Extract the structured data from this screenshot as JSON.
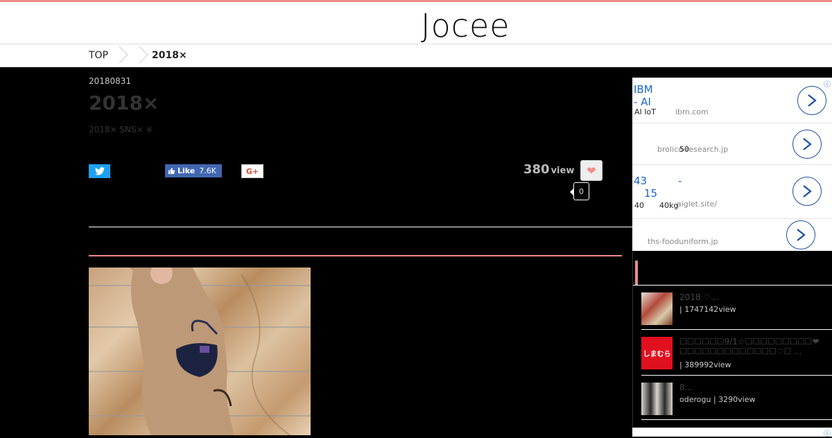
{
  "site": {
    "logo": "Jocee"
  },
  "breadcrumb": {
    "top": "TOP",
    "current": "2018×"
  },
  "article": {
    "date": "20180831",
    "title": "2018×",
    "description": "2018× SNS× ※",
    "views": "380",
    "views_label": "view",
    "like_count": "0"
  },
  "share": {
    "facebook_label": "Like",
    "facebook_count": "7.6K",
    "gplus_label": "G+"
  },
  "ads": [
    {
      "title_line1": "IBM",
      "title_line2": "- AI",
      "sub": "AI IoT",
      "url": "ibm.com"
    },
    {
      "sub": "50",
      "url": "brolico-research.jp"
    },
    {
      "title_line1": "43　　　-",
      "title_line2": "　15",
      "sub": "40　　40kg",
      "url": "aiglet.site/"
    },
    {
      "url": "ths-fooduniform.jp"
    }
  ],
  "ranking": [
    {
      "title": "2018 ♡...",
      "meta": " | 1747142view",
      "thumb_color": "#b04a3a"
    },
    {
      "title": "☐☐☐☐☐☐9/1☆☐☐☐☐☐☐☐☐☐❤☐☐☐☐☐☐☐☐☐☐☐☐☐♡☐ ...",
      "meta": " | 389992view",
      "thumb_label": "しまむら",
      "thumb_color": "#e0101f"
    },
    {
      "title": "8...",
      "meta": "oderogu | 3290view",
      "thumb_color": "#3a3a3a"
    }
  ],
  "colors": {
    "accent": "#f08c87",
    "twitter": "#1da1f2",
    "facebook": "#4267b2",
    "ad_link": "#1a64c8"
  }
}
